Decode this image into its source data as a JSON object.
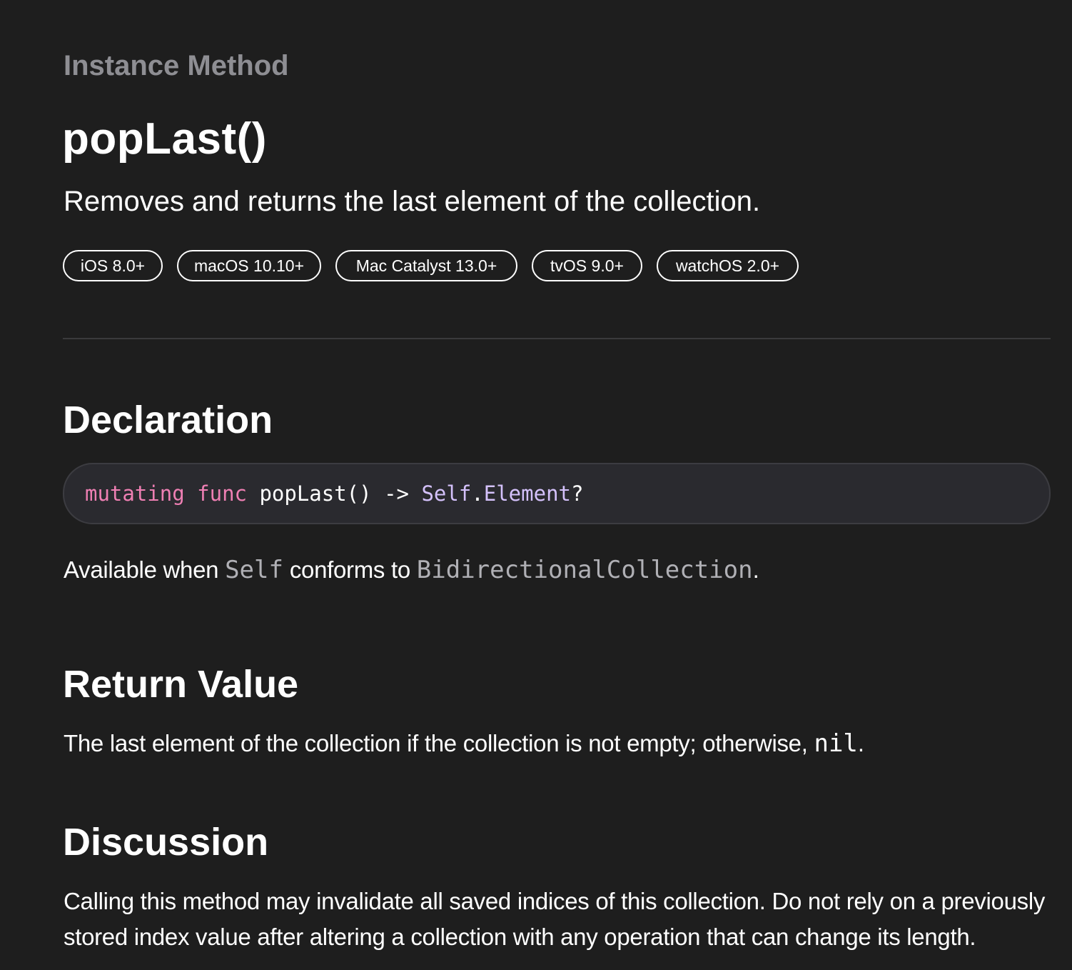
{
  "header": {
    "eyebrow": "Instance Method",
    "title": "popLast()",
    "abstract": "Removes and returns the last element of the collection."
  },
  "availability": [
    "iOS 8.0+",
    "macOS 10.10+",
    "Mac Catalyst 13.0+",
    "tvOS 9.0+",
    "watchOS 2.0+"
  ],
  "declaration": {
    "heading": "Declaration",
    "code": {
      "keyword_mutating": "mutating",
      "keyword_func": "func",
      "name": "popLast() ->",
      "type_self": "Self",
      "dot": ".",
      "type_element": "Element",
      "optional": "?"
    },
    "availability_note": {
      "prefix": "Available when ",
      "self_code": "Self",
      "middle": " conforms to ",
      "protocol_code": "BidirectionalCollection",
      "suffix": "."
    }
  },
  "return_value": {
    "heading": "Return Value",
    "text_before": "The last element of the collection if the collection is not empty; otherwise, ",
    "code": "nil",
    "text_after": "."
  },
  "discussion": {
    "heading": "Discussion",
    "text": "Calling this method may invalidate all saved indices of this collection. Do not rely on a previously stored index value after altering a collection with any operation that can change its length."
  },
  "colors": {
    "background": "#1e1e1e",
    "eyebrow": "#8e8e93",
    "keyword": "#ee7fb3",
    "type": "#d4c1fb",
    "code_background": "#2a2a2f"
  }
}
